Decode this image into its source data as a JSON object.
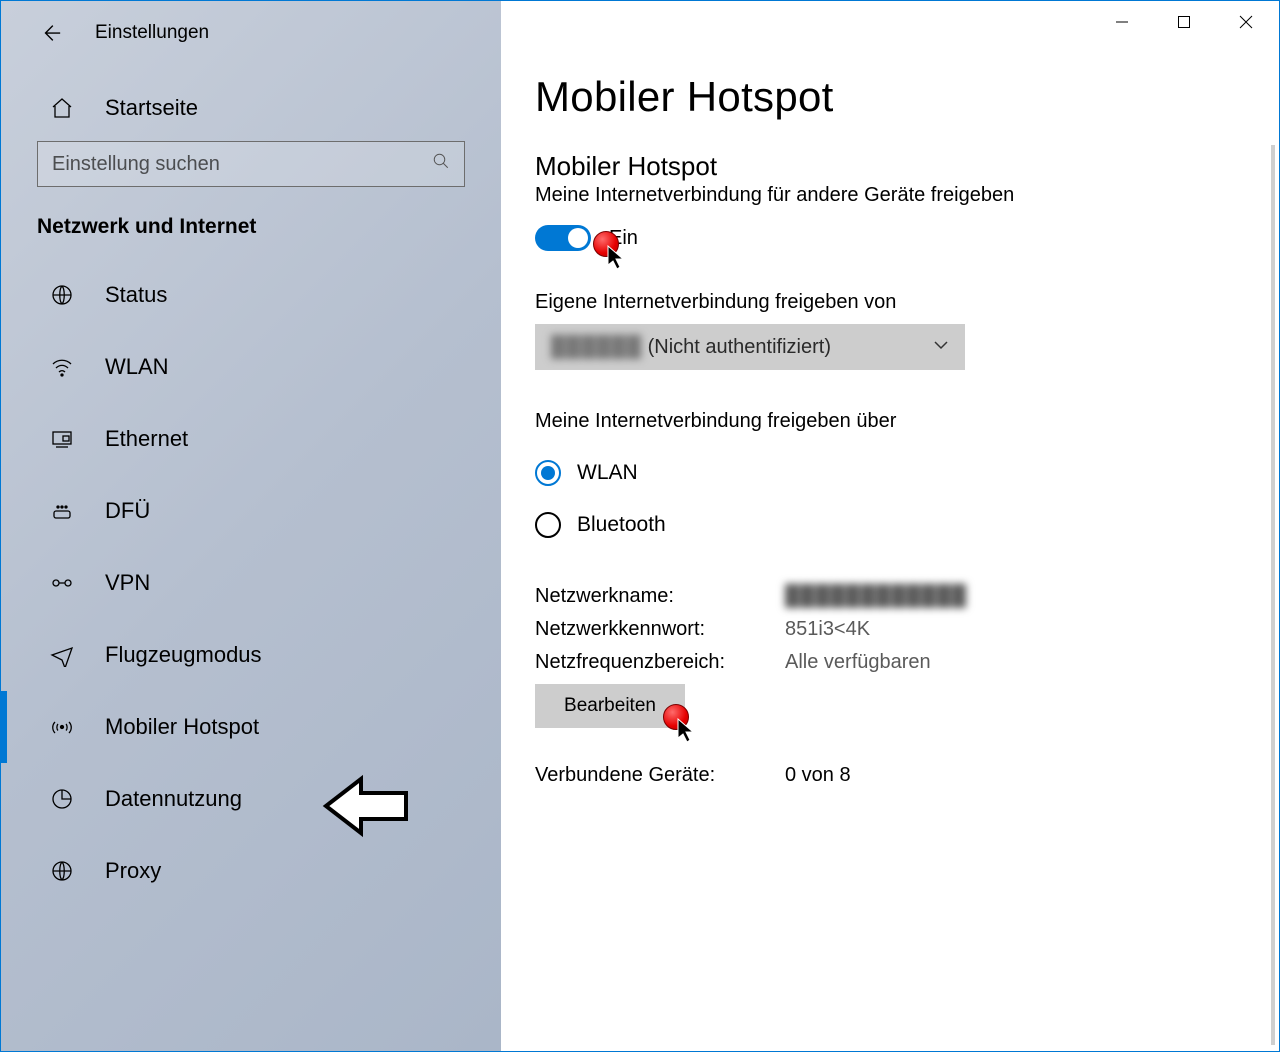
{
  "window": {
    "app_title": "Einstellungen"
  },
  "sidebar": {
    "home_label": "Startseite",
    "search_placeholder": "Einstellung suchen",
    "category_label": "Netzwerk und Internet",
    "items": [
      {
        "label": "Status"
      },
      {
        "label": "WLAN"
      },
      {
        "label": "Ethernet"
      },
      {
        "label": "DFÜ"
      },
      {
        "label": "VPN"
      },
      {
        "label": "Flugzeugmodus"
      },
      {
        "label": "Mobiler Hotspot"
      },
      {
        "label": "Datennutzung"
      },
      {
        "label": "Proxy"
      }
    ]
  },
  "main": {
    "page_title": "Mobiler Hotspot",
    "hotspot": {
      "section_title": "Mobiler Hotspot",
      "section_sub": "Meine Internetverbindung für andere Geräte freigeben",
      "toggle_label": "Ein",
      "toggle_on": true
    },
    "share_from": {
      "label": "Eigene Internetverbindung freigeben von",
      "selected_redacted": "██████",
      "selected_suffix": "(Nicht authentifiziert)"
    },
    "share_over": {
      "label": "Meine Internetverbindung freigeben über",
      "options": [
        {
          "label": "WLAN",
          "selected": true
        },
        {
          "label": "Bluetooth",
          "selected": false
        }
      ]
    },
    "network": {
      "name_label": "Netzwerkname:",
      "name_value": "████████████",
      "password_label": "Netzwerkkennwort:",
      "password_value": "851i3<4K",
      "band_label": "Netzfrequenzbereich:",
      "band_value": "Alle verfügbaren",
      "edit_label": "Bearbeiten"
    },
    "connected": {
      "label": "Verbundene Geräte:",
      "value": "0 von 8"
    }
  }
}
